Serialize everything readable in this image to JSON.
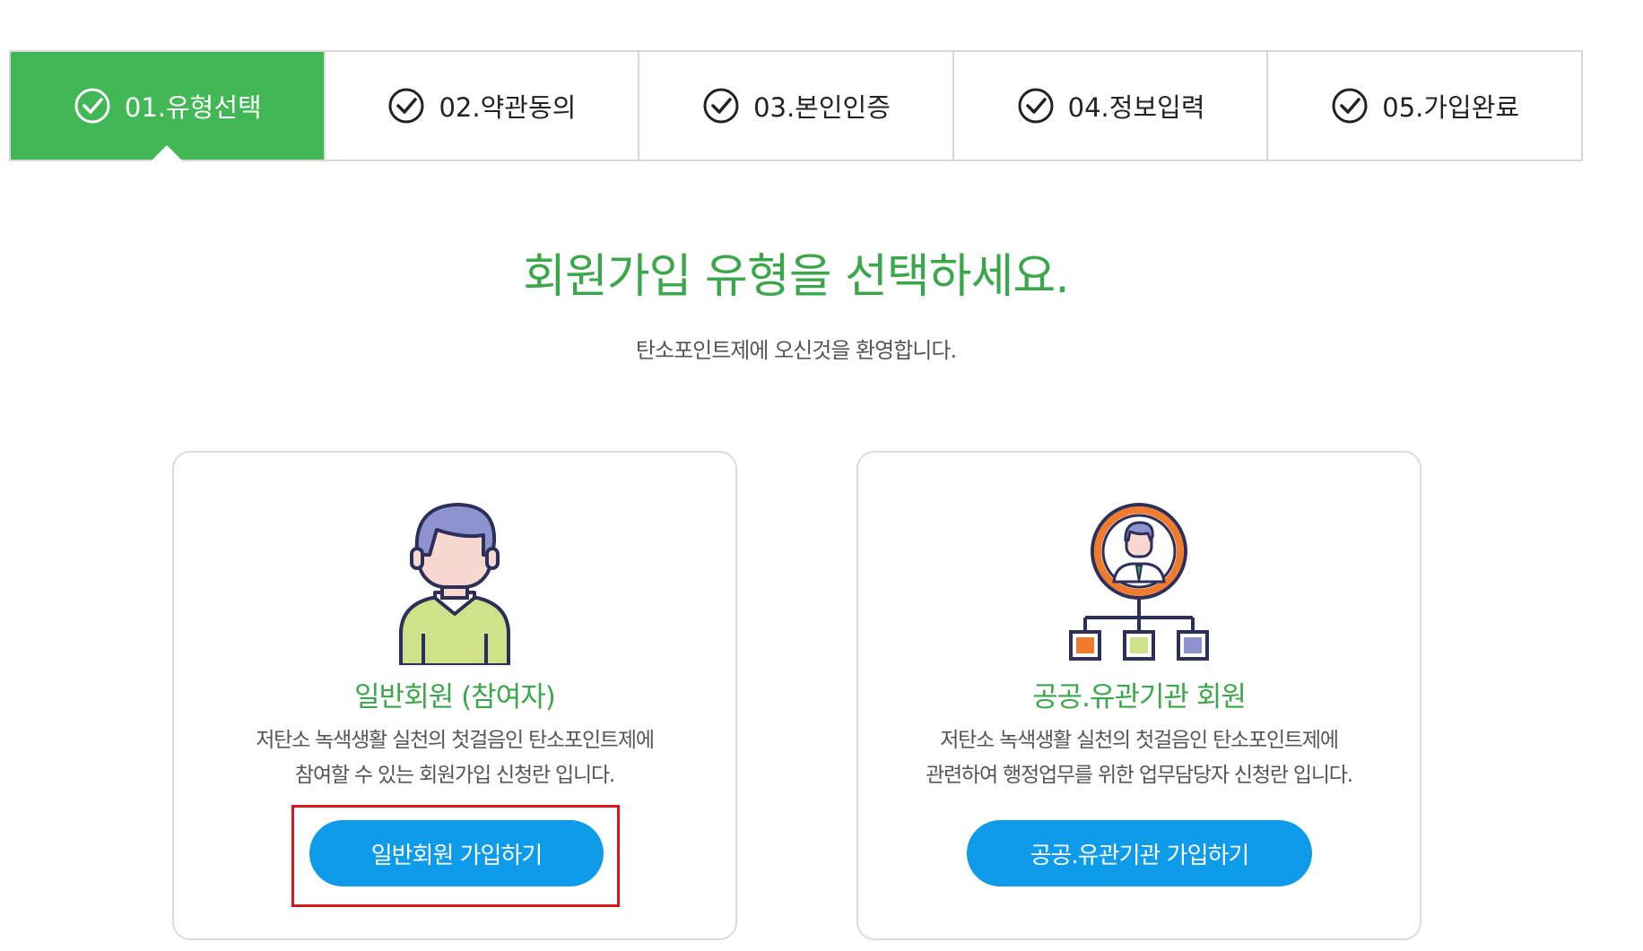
{
  "steps": [
    {
      "label": "01.유형선택",
      "active": true
    },
    {
      "label": "02.약관동의",
      "active": false
    },
    {
      "label": "03.본인인증",
      "active": false
    },
    {
      "label": "04.정보입력",
      "active": false
    },
    {
      "label": "05.가입완료",
      "active": false
    }
  ],
  "main": {
    "title": "회원가입 유형을 선택하세요.",
    "subtitle": "탄소포인트제에 오신것을 환영합니다."
  },
  "cards": {
    "general": {
      "title": "일반회원 (참여자)",
      "desc_line1": "저탄소 녹색생활 실천의 첫걸음인 탄소포인트제에",
      "desc_line2": "참여할 수 있는 회원가입 신청란 입니다.",
      "button_label": "일반회원 가입하기",
      "icon": "person-icon"
    },
    "public": {
      "title": "공공.유관기관 회원",
      "desc_line1": "저탄소 녹색생활 실천의 첫걸음인 탄소포인트제에",
      "desc_line2": "관련하여 행정업무를 위한 업무담당자 신청란 입니다.",
      "button_label": "공공.유관기관 가입하기",
      "icon": "organization-chart-icon"
    }
  },
  "colors": {
    "active_step": "#41b755",
    "heading_green": "#3aa84a",
    "button_blue": "#0d9bea",
    "highlight_red": "#e0151b"
  }
}
